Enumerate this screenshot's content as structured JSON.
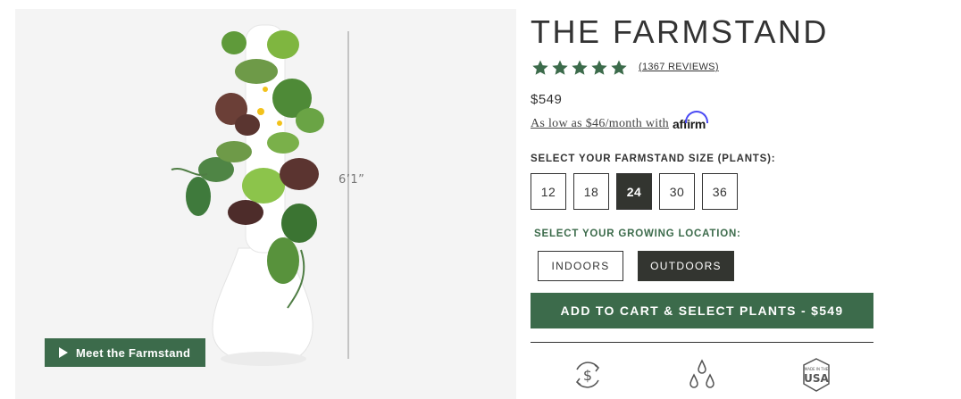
{
  "product": {
    "title": "THE FARMSTAND",
    "rating": 5,
    "reviews_label": "(1367 REVIEWS)",
    "price": "$549",
    "financing_text": "As low as $46/month with",
    "financing_brand": "affirm"
  },
  "image": {
    "height_label": "6’1”",
    "video_button_label": "Meet the Farmstand"
  },
  "size_selector": {
    "label": "SELECT YOUR FARMSTAND SIZE (PLANTS):",
    "options": [
      "12",
      "18",
      "24",
      "30",
      "36"
    ],
    "selected": "24"
  },
  "location_selector": {
    "label": "SELECT YOUR GROWING LOCATION:",
    "options": [
      "INDOORS",
      "OUTDOORS"
    ],
    "selected": "OUTDOORS"
  },
  "cart": {
    "button_label": "ADD TO CART & SELECT PLANTS - $549"
  },
  "feature_icons": [
    "dollar-cycle-icon",
    "water-drops-icon",
    "made-in-usa-icon"
  ],
  "colors": {
    "brand_green": "#3c6b4b",
    "selected_dark": "#333530",
    "star_green": "#3c6b4b",
    "affirm_blue": "#4a4af4"
  }
}
